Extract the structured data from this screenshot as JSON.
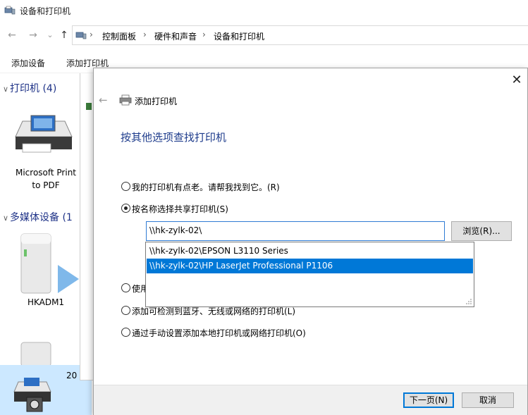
{
  "window": {
    "title": "设备和打印机"
  },
  "nav": {
    "back": "←",
    "forward": "→",
    "recent": "⌄",
    "up": "↑",
    "breadcrumb": [
      "控制面板",
      "硬件和声音",
      "设备和打印机"
    ],
    "separator": "›"
  },
  "toolbar": {
    "add_device": "添加设备",
    "add_printer": "添加打印机"
  },
  "groups": {
    "printers": {
      "chevron": "∨",
      "label": "打印机 (4)"
    },
    "multimedia": {
      "chevron": "∨",
      "label": "多媒体设备 (1"
    }
  },
  "devices": {
    "pdf_printer": {
      "line1": "Microsoft Print",
      "line2": "to PDF"
    },
    "media": {
      "label": "HKADM1"
    },
    "partial_count": "20"
  },
  "dialog": {
    "close": "✕",
    "back": "←",
    "title": "添加打印机",
    "heading": "按其他选项查找打印机",
    "options": [
      {
        "label": "我的打印机有点老。请帮我找到它。(R)",
        "selected": false
      },
      {
        "label": "按名称选择共享打印机(S)",
        "selected": true
      },
      {
        "label": "使用",
        "selected": false
      },
      {
        "label": "添加可检测到蓝牙、无线或网络的打印机(L)",
        "selected": false
      },
      {
        "label": "通过手动设置添加本地打印机或网络打印机(O)",
        "selected": false
      }
    ],
    "share_input": {
      "value": "\\\\hk-zylk-02\\"
    },
    "browse": "浏览(R)...",
    "suggestions": [
      {
        "label": "\\\\hk-zylk-02\\EPSON L3110 Series",
        "selected": false
      },
      {
        "label": "\\\\hk-zylk-02\\HP LaserJet Professional P1106",
        "selected": true
      }
    ],
    "next": "下一页(N)",
    "cancel": "取消"
  },
  "colors": {
    "accent": "#0078d7",
    "heading": "#1e3c8c",
    "group": "#1e3287"
  }
}
